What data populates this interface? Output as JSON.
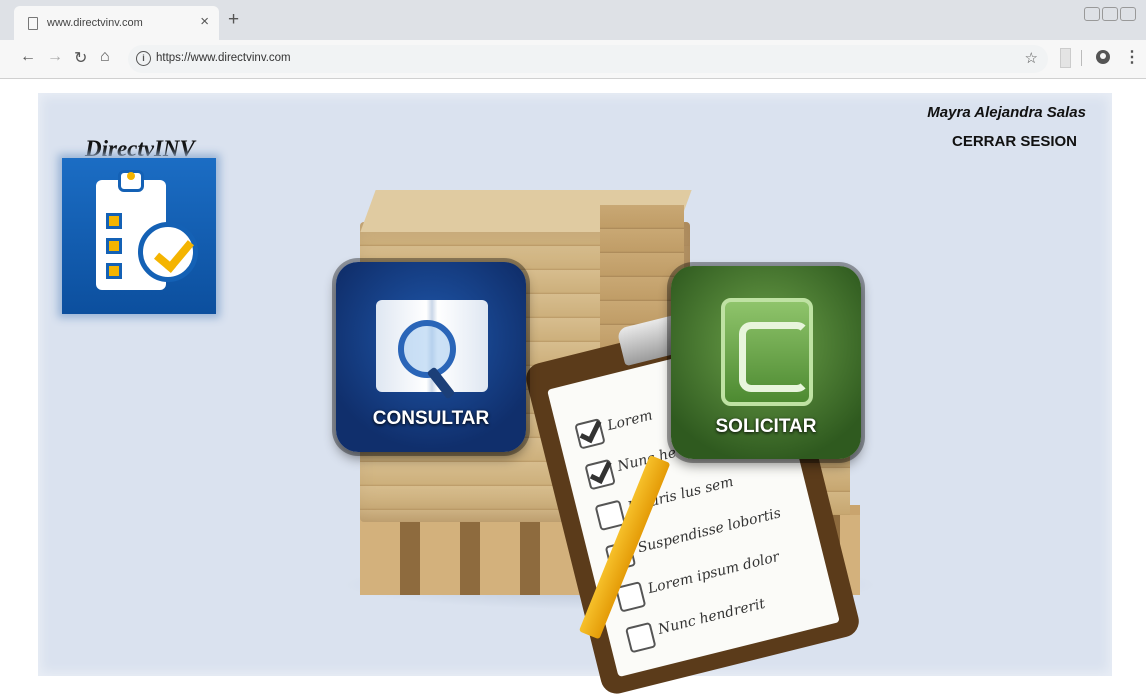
{
  "browser": {
    "tab_title": "www.directvinv.com",
    "tab_close": "×",
    "new_tab": "+",
    "url": "https://www.directvinv.com",
    "star": "☆",
    "menu": "⋮"
  },
  "app": {
    "brand": "DirectvINV"
  },
  "header": {
    "user_name": "Mayra Alejandra Salas",
    "logout_label": "CERRAR SESION"
  },
  "actions": {
    "consult_label": "CONSULTAR",
    "request_label": "SOLICITAR"
  },
  "checklist": [
    {
      "text": "Lorem",
      "checked": true
    },
    {
      "text": "Nunc he",
      "checked": true
    },
    {
      "text": "Mauris lus sem",
      "checked": false
    },
    {
      "text": "Suspendisse lobortis",
      "checked": true
    },
    {
      "text": "Lorem ipsum dolor",
      "checked": false
    },
    {
      "text": "Nunc hendrerit",
      "checked": false
    }
  ],
  "colors": {
    "page_background": "#dae2ef",
    "consult_button": "#1b4a9a",
    "request_button": "#4a7d2e",
    "logo_blue": "#1461b5",
    "logo_accent": "#f4b400"
  }
}
